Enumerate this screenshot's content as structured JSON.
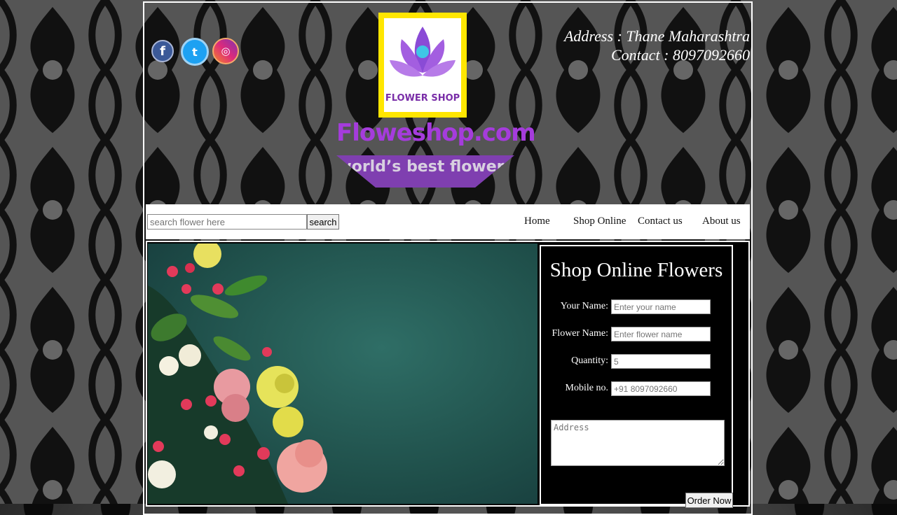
{
  "header": {
    "social": [
      {
        "name": "facebook",
        "glyph": "f"
      },
      {
        "name": "twitter",
        "glyph": "t"
      },
      {
        "name": "instagram",
        "glyph": "◎"
      }
    ],
    "logo_text": "FLOWER SHOP",
    "site_name": "Floweshop.com",
    "tagline": "world’s best flowers",
    "address": "Address : Thane Maharashtra",
    "contact": "Contact : 8097092660"
  },
  "nav": {
    "search_placeholder": "search flower here",
    "search_label": "search",
    "items": [
      "Home",
      "Shop Online",
      "Contact us",
      "About us"
    ]
  },
  "form": {
    "title": "Shop Online Flowers",
    "fields": [
      {
        "label": "Your Name:",
        "placeholder": "Enter your name"
      },
      {
        "label": "Flower Name:",
        "placeholder": "Enter flower name"
      },
      {
        "label": "Quantity:",
        "placeholder": "5"
      },
      {
        "label": "Mobile no.",
        "placeholder": "+91 8097092660"
      }
    ],
    "address_placeholder": "Address",
    "submit_label": "Order Now"
  },
  "colors": {
    "brand_purple": "#a53cdc",
    "logo_yellow": "#ffe600",
    "panel_black": "#000000"
  }
}
